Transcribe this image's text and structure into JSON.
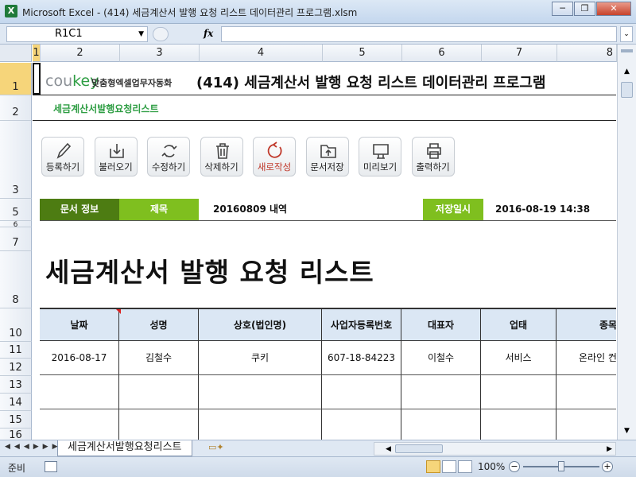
{
  "window": {
    "title": "Microsoft Excel - (414) 세금계산서 발행 요청 리스트 데이터관리 프로그램.xlsm",
    "app_icon": "X",
    "minimize": "─",
    "restore": "❐",
    "close": "✕"
  },
  "formula_bar": {
    "name_box": "R1C1",
    "fx": "fx",
    "formula": ""
  },
  "columns": [
    "1",
    "2",
    "3",
    "4",
    "5",
    "6",
    "7",
    "8"
  ],
  "rows": [
    "1",
    "2",
    "3",
    "5",
    "6",
    "7",
    "8",
    "10",
    "11",
    "12",
    "13",
    "14",
    "15",
    "16"
  ],
  "header": {
    "logo_main": "cou",
    "logo_accent": "key",
    "logo_sub": "맞춤형엑셀업무자동화",
    "title": "(414) 세금계산서 발행 요청 리스트 데이터관리 프로그램"
  },
  "subtitle": "세금계산서발행요청리스트",
  "toolbar": [
    {
      "label": "등록하기",
      "icon": "pencil-icon"
    },
    {
      "label": "불러오기",
      "icon": "download-icon"
    },
    {
      "label": "수정하기",
      "icon": "refresh-icon"
    },
    {
      "label": "삭제하기",
      "icon": "trash-icon"
    },
    {
      "label": "새로작성",
      "icon": "new-icon"
    },
    {
      "label": "문서저장",
      "icon": "save-icon"
    },
    {
      "label": "미리보기",
      "icon": "preview-icon"
    },
    {
      "label": "출력하기",
      "icon": "print-icon"
    }
  ],
  "info": {
    "doc_info_label": "문서 정보",
    "subject_label": "제목",
    "subject_value": "20160809 내역",
    "saved_label": "저장일시",
    "saved_value": "2016-08-19 14:38"
  },
  "big_title": "세금계산서 발행 요청 리스트",
  "table": {
    "headers": [
      "날짜",
      "성명",
      "상호(법인명)",
      "사업자등록번호",
      "대표자",
      "업태",
      "종목"
    ],
    "rows": [
      [
        "2016-08-17",
        "김철수",
        "쿠키",
        "607-18-84223",
        "이철수",
        "서비스",
        "온라인 컨"
      ]
    ]
  },
  "sheet_tab": "세금계산서발행요청리스트",
  "status": {
    "ready": "준비",
    "zoom": "100%"
  }
}
